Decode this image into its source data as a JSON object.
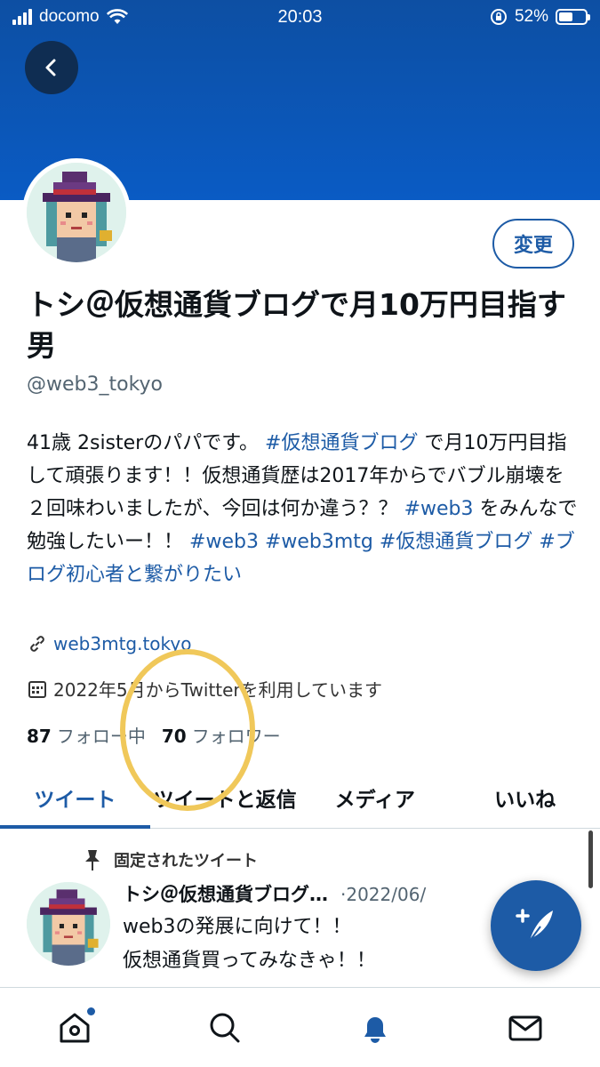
{
  "status_bar": {
    "carrier": "docomo",
    "time": "20:03",
    "battery": "52%",
    "battery_level": 0.52
  },
  "profile": {
    "edit_label": "変更",
    "display_name": "トシ＠仮想通貨ブログで月10万円目指す男",
    "handle": "@web3_tokyo",
    "bio": {
      "t1": "41歳 2sisterのパパです。",
      "tag1": "#仮想通貨ブログ",
      "t2": "で月10万円目指して頑張ります！！仮想通貨歴は2017年からでバブル崩壊を２回味わいましたが、今回は何か違う？？",
      "tag2": "#web3",
      "t3": "をみんなで勉強したいー！！",
      "tag3": "#web3",
      "tag4": "#web3mtg",
      "tag5": "#仮想通貨ブログ",
      "tag6": "#ブログ初心者と繋がりたい"
    },
    "website": "web3mtg.tokyo",
    "joined": "2022年5月からTwitterを利用しています",
    "following_count": "87",
    "following_label": "フォロー中",
    "followers_count": "70",
    "followers_label": "フォロワー"
  },
  "tabs": [
    {
      "label": "ツイート",
      "active": true
    },
    {
      "label": "ツイートと返信",
      "active": false
    },
    {
      "label": "メディア",
      "active": false
    },
    {
      "label": "いいね",
      "active": false
    }
  ],
  "pinned_tweet": {
    "pinned_label": "固定されたツイート",
    "author": "トシ＠仮想通貨ブログ…",
    "date": "·2022/06/",
    "line1": "web3の発展に向けて！！",
    "line2": "仮想通貨買ってみなきゃ！！"
  },
  "colors": {
    "accent": "#1d5ba6",
    "banner": "#0a5bc4",
    "highlight_circle": "#f0c85a"
  },
  "icons": {
    "back": "arrow-left-icon",
    "link": "link-icon",
    "calendar": "calendar-icon",
    "pin": "pin-icon",
    "compose": "compose-feather-icon",
    "home": "home-icon",
    "search": "search-icon",
    "notifications": "bell-icon",
    "messages": "mail-icon"
  }
}
